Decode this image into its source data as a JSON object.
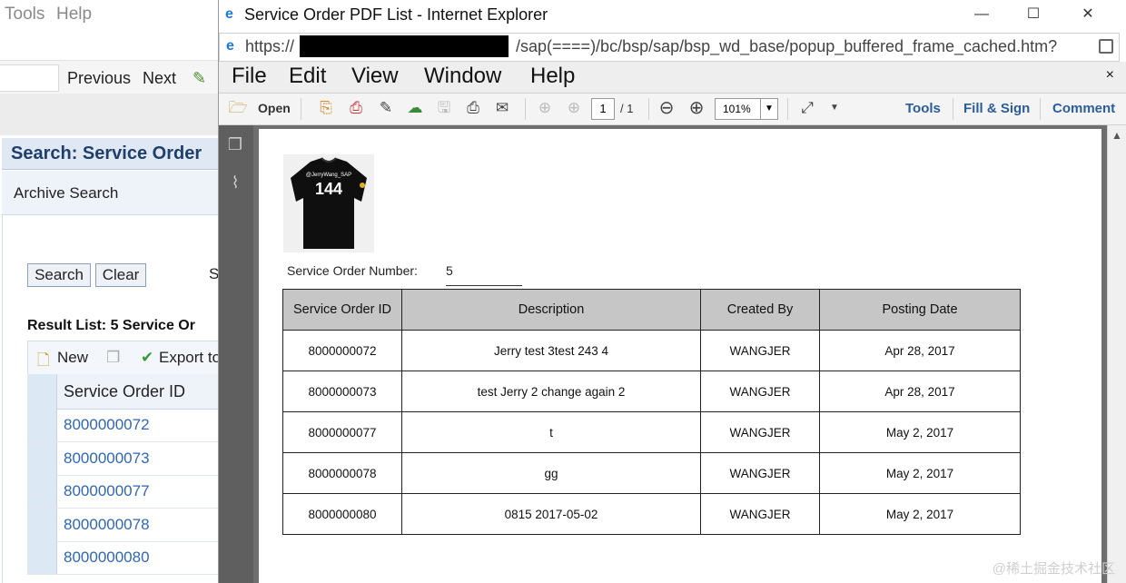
{
  "bg": {
    "menu": [
      "Tools",
      "Help"
    ],
    "toolbar": {
      "previous": "Previous",
      "next": "Next"
    },
    "header_title": "Search: Service Order",
    "archive_search": "Archive Search",
    "buttons": {
      "search": "Search",
      "clear": "Clear",
      "cut_letter": "S"
    },
    "result_list": "Result List: 5 Service Or",
    "list_toolbar": {
      "new": "New",
      "export": "Export to"
    },
    "column_header": "Service Order ID",
    "rows": [
      "8000000072",
      "8000000073",
      "8000000077",
      "8000000078",
      "8000000080"
    ]
  },
  "ie": {
    "title": "Service Order PDF List - Internet Explorer",
    "url_prefix": "https://",
    "url_suffix": "/sap(====)/bc/bsp/sap/bsp_wd_base/popup_buffered_frame_cached.htm?"
  },
  "reader": {
    "menu": [
      "File",
      "Edit",
      "View",
      "Window",
      "Help"
    ],
    "toolbar": {
      "open": "Open",
      "page_current": "1",
      "page_total": "/ 1",
      "zoom": "101%",
      "tools": "Tools",
      "fill_sign": "Fill & Sign",
      "comment": "Comment"
    }
  },
  "pdf": {
    "shirt_name": "@JerryWang_SAP",
    "shirt_number": "144",
    "service_order_number_label": "Service Order Number:",
    "service_order_number_value": "5",
    "table": {
      "headers": [
        "Service Order ID",
        "Description",
        "Created By",
        "Posting Date"
      ],
      "rows": [
        [
          "8000000072",
          "Jerry test 3test 243 4",
          "WANGJER",
          "Apr 28, 2017"
        ],
        [
          "8000000073",
          "test Jerry 2 change again 2",
          "WANGJER",
          "Apr 28, 2017"
        ],
        [
          "8000000077",
          "t",
          "WANGJER",
          "May 2, 2017"
        ],
        [
          "8000000078",
          "gg",
          "WANGJER",
          "May 2, 2017"
        ],
        [
          "8000000080",
          "0815 2017-05-02",
          "WANGJER",
          "May 2, 2017"
        ]
      ]
    }
  },
  "watermark": "@稀土掘金技术社区"
}
